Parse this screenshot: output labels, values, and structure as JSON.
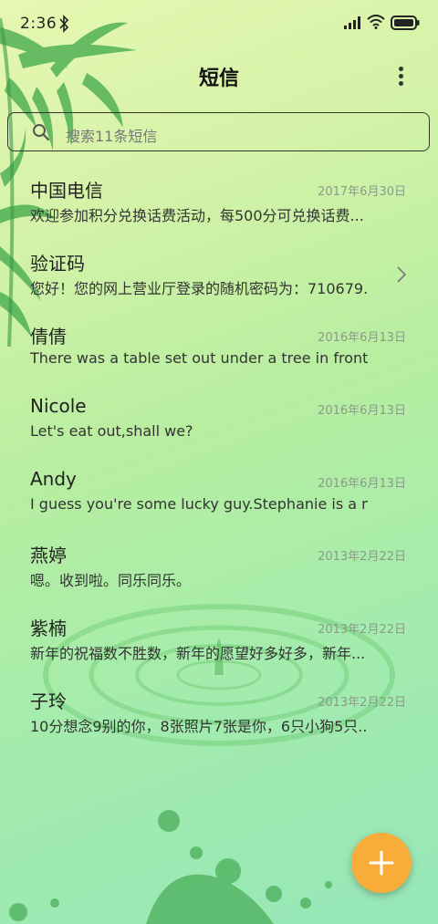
{
  "status_bar": {
    "time": "2:36",
    "icons": [
      "bluetooth-icon",
      "signal-icon",
      "wifi-icon",
      "battery-icon"
    ]
  },
  "header": {
    "title": "短信",
    "more_icon": "more-vertical-icon"
  },
  "search": {
    "placeholder": "搜索11条短信",
    "icon": "search-icon"
  },
  "messages": [
    {
      "name": "中国电信",
      "date": "2017年6月30日",
      "preview": "欢迎参加积分兑换话费活动，每500分可兑换话费..."
    },
    {
      "name": "验证码",
      "date": "",
      "preview": "您好！您的网上营业厅登录的随机密码为：710679..."
    },
    {
      "name": "倩倩",
      "date": "2016年6月13日",
      "preview": "There was a table set out under a tree in front o..."
    },
    {
      "name": "Nicole",
      "date": "2016年6月13日",
      "preview": "Let's eat out,shall we?"
    },
    {
      "name": "Andy",
      "date": "2016年6月13日",
      "preview": "I guess you're some lucky guy.Stephanie is a ni..."
    },
    {
      "name": "燕婷",
      "date": "2013年2月22日",
      "preview": "嗯。收到啦。同乐同乐。"
    },
    {
      "name": "紫楠",
      "date": "2013年2月22日",
      "preview": "新年的祝福数不胜数，新年的愿望好多好多，新年..."
    },
    {
      "name": "子玲",
      "date": "2013年2月22日",
      "preview": "10分想念9别的你，8张照片7张是你，6只小狗5只..."
    }
  ],
  "fab": {
    "icon": "plus-icon"
  },
  "colors": {
    "fab": "#f8ac3a",
    "accent_green": "#2e9a3a"
  }
}
